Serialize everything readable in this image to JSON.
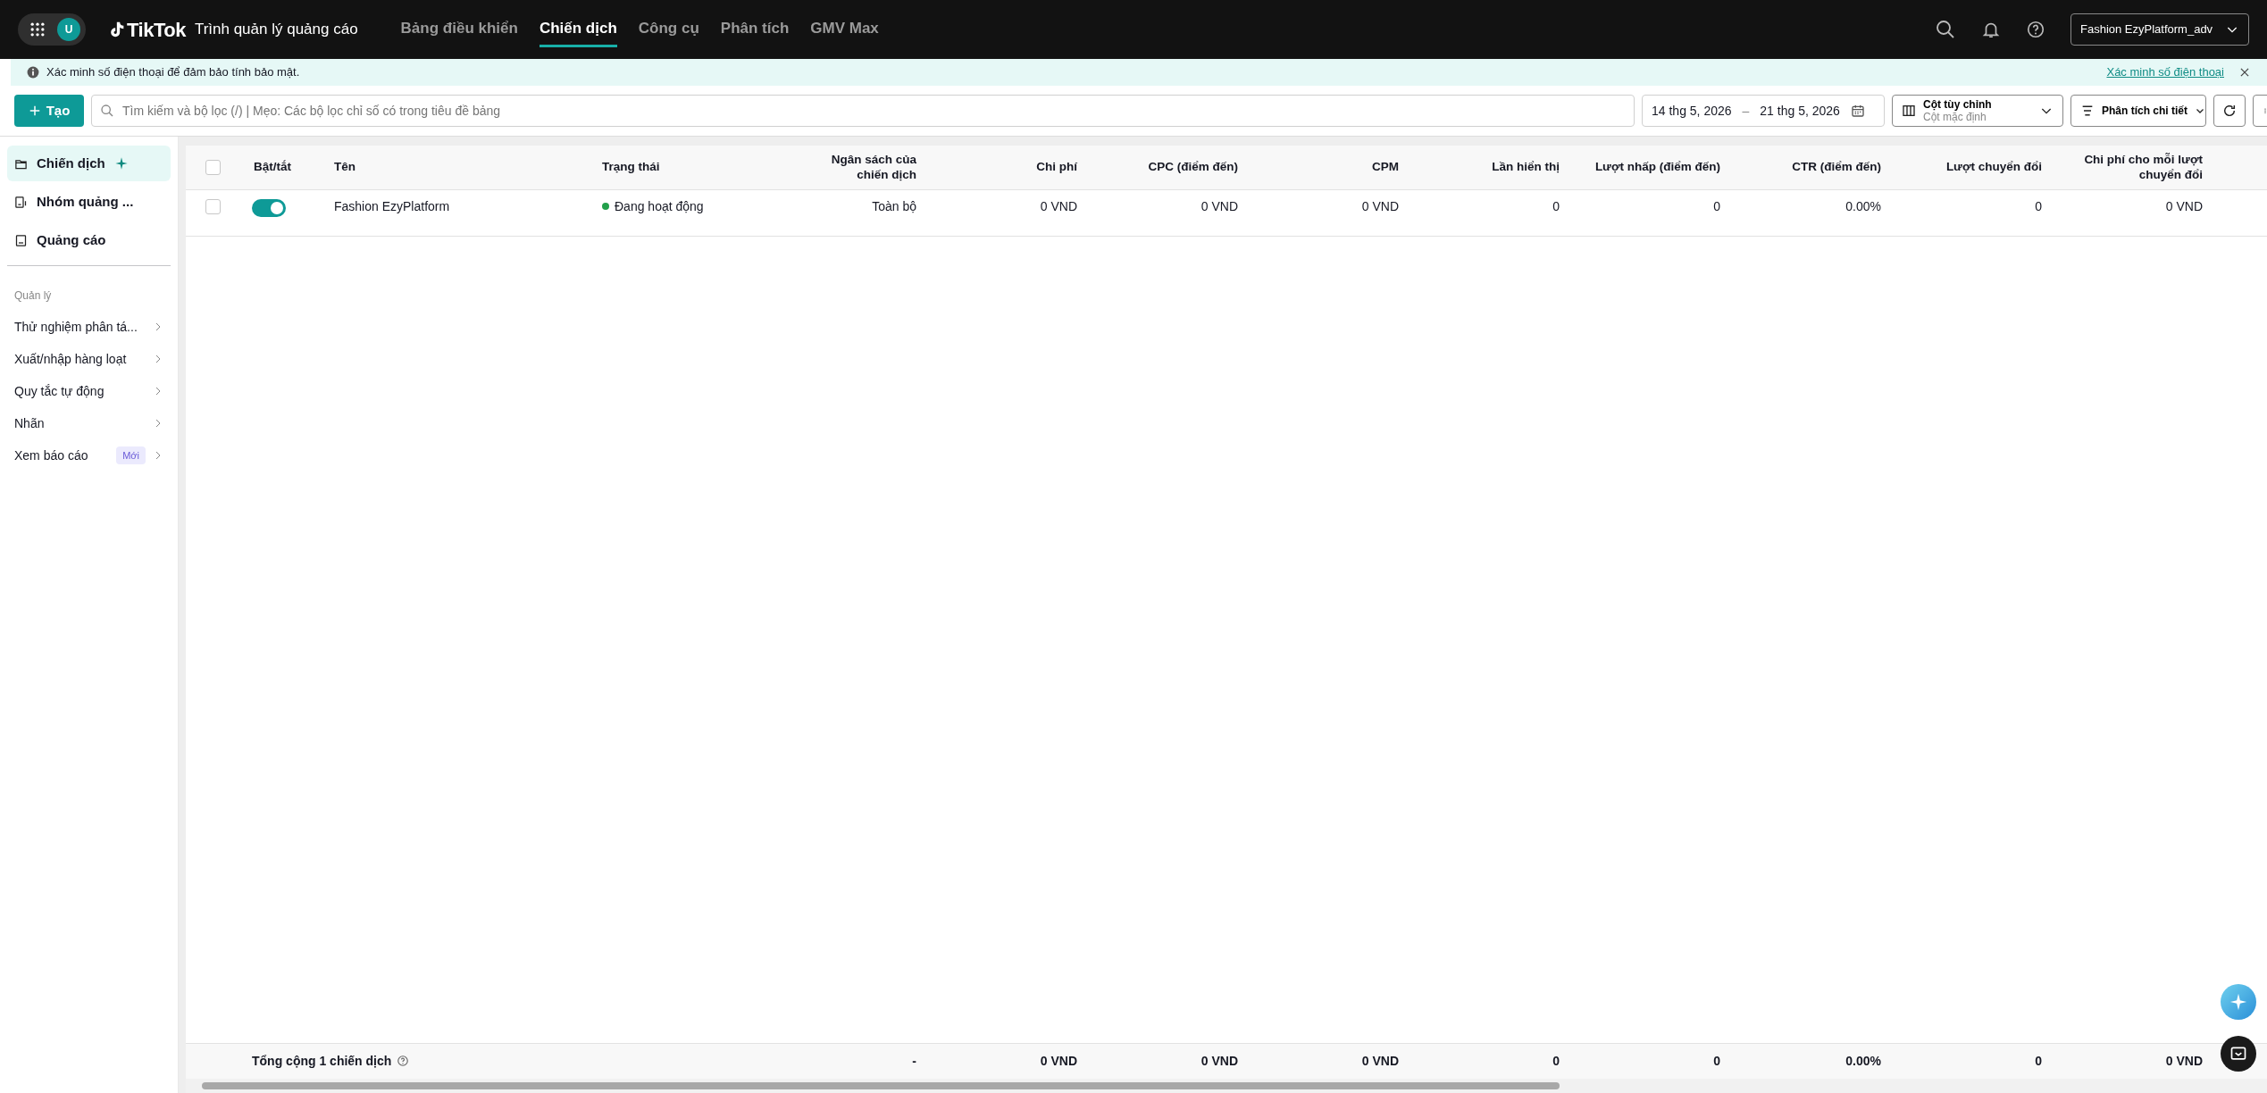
{
  "topbar": {
    "avatar_letter": "U",
    "brand": "TikTok",
    "product": "Trình quản lý quảng cáo",
    "nav": [
      {
        "label": "Bảng điều khiển",
        "selected": false
      },
      {
        "label": "Chiến dịch",
        "selected": true
      },
      {
        "label": "Công cụ",
        "selected": false
      },
      {
        "label": "Phân tích",
        "selected": false
      },
      {
        "label": "GMV Max",
        "selected": false
      }
    ],
    "account": "Fashion EzyPlatform_adv"
  },
  "banner": {
    "message": "Xác minh số điện thoại để đảm bảo tính bảo mật.",
    "link": "Xác minh số điện thoại"
  },
  "toolbar": {
    "create": "Tạo",
    "search": {
      "placeholder": "Tìm kiếm và bộ lọc (/) | Mẹo: Các bộ lọc chỉ số có trong tiêu đề bảng"
    },
    "date_start": "14 thg 5, 2026",
    "date_sep": "–",
    "date_end": "21 thg 5, 2026",
    "columns_title": "Cột tùy chỉnh",
    "columns_sub": "Cột mặc định",
    "breakdown": "Phân tích chi tiết"
  },
  "sidebar": {
    "items": [
      {
        "label": "Chiến dịch",
        "kind": "campaign",
        "selected": true
      },
      {
        "label": "Nhóm quảng ...",
        "kind": "adgroup",
        "selected": false
      },
      {
        "label": "Quảng cáo",
        "kind": "ad",
        "selected": false
      }
    ],
    "section": "Quản lý",
    "manage": [
      {
        "label": "Thử nghiệm phân tá..."
      },
      {
        "label": "Xuất/nhập hàng loạt"
      },
      {
        "label": "Quy tắc tự động"
      },
      {
        "label": "Nhãn"
      },
      {
        "label": "Xem báo cáo",
        "badge": "Mới"
      }
    ]
  },
  "table": {
    "select_all_checked": false,
    "columns": [
      "Bật/tắt",
      "Tên",
      "Trạng thái",
      "Ngân sách của chiến dịch",
      "Chi phí",
      "CPC (điểm đến)",
      "CPM",
      "Lần hiển thị",
      "Lượt nhấp (điểm đến)",
      "CTR (điểm đến)",
      "Lượt chuyển đổi",
      "Chi phí cho mỗi lượt chuyển đổi"
    ],
    "rows": [
      {
        "checked": false,
        "cells": [
          {
            "kind": "toggle",
            "on": true
          },
          {
            "kind": "name",
            "text": "Fashion EzyPlatform"
          },
          {
            "kind": "status",
            "text": "Đang hoạt động",
            "color": "#22a04b"
          },
          {
            "kind": "text",
            "text": "Toàn bộ"
          },
          {
            "kind": "text",
            "text": "0 VND"
          },
          {
            "kind": "text",
            "text": "0 VND"
          },
          {
            "kind": "text",
            "text": "0 VND"
          },
          {
            "kind": "text",
            "text": "0"
          },
          {
            "kind": "text",
            "text": "0"
          },
          {
            "kind": "text",
            "text": "0.00%"
          },
          {
            "kind": "text",
            "text": "0"
          },
          {
            "kind": "text",
            "text": "0 VND"
          }
        ]
      }
    ],
    "total": {
      "label": "Tổng cộng 1 chiến dịch",
      "cells": [
        "-",
        "0 VND",
        "0 VND",
        "0 VND",
        "0",
        "0",
        "0.00%",
        "0",
        "0 VND"
      ]
    }
  }
}
